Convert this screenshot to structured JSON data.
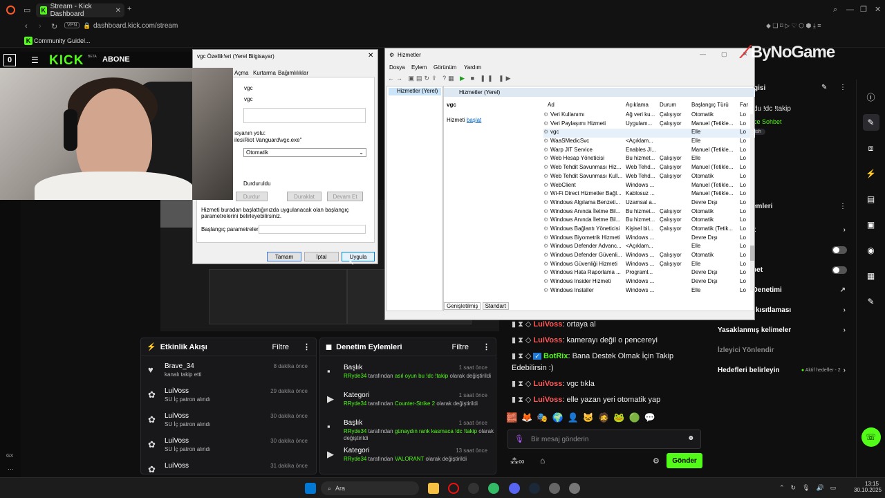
{
  "browser": {
    "tab_title": "Stream - Kick Dashboard",
    "vpn_label": "VPN",
    "url": "dashboard.kick.com/stream",
    "bookmark": "Community Guidel..."
  },
  "kick": {
    "logo": "KICK",
    "beta": "BETA",
    "abone": "ABONE",
    "watermark": "ByNoGame"
  },
  "activity": {
    "title": "Etkinlik Akışı",
    "filter": "Filtre",
    "items": [
      {
        "name": "Brave_34",
        "time": "8 dakika önce",
        "sub": "kanalı takip etti"
      },
      {
        "name": "LuiVoss",
        "time": "29 dakika önce",
        "sub": "SU İç patron alındı"
      },
      {
        "name": "LuiVoss",
        "time": "30 dakika önce",
        "sub": "SU İç patron alındı"
      },
      {
        "name": "LuiVoss",
        "time": "30 dakika önce",
        "sub": "SU İç patron alındı"
      },
      {
        "name": "LuiVoss",
        "time": "31 dakika önce",
        "sub": ""
      }
    ]
  },
  "moderation": {
    "title": "Denetim Eylemleri",
    "filter": "Filtre",
    "items": [
      {
        "type": "Başlık",
        "time": "1 saat önce",
        "user": "RRyde34",
        "pre": " tarafından ",
        "hl": "asıl oyun bu !dc !takip",
        "post": " olarak değiştirildi"
      },
      {
        "type": "Kategori",
        "time": "1 saat önce",
        "user": "RRyde34",
        "pre": " tarafından ",
        "hl": "Counter-Strike 2",
        "post": " olarak değiştirildi"
      },
      {
        "type": "Başlık",
        "time": "1 saat önce",
        "user": "RRyde34",
        "pre": " tarafından ",
        "hl": "günaydın rank kasmaca !dc !takip",
        "post": " olarak değiştirildi"
      },
      {
        "type": "Kategori",
        "time": "13 saat önce",
        "user": "RRyde34",
        "pre": " tarafından ",
        "hl": "VALORANT",
        "post": " olarak değiştirildi"
      }
    ]
  },
  "chat": {
    "lines": [
      {
        "user": "LuiVoss",
        "msg": ": ortaya al",
        "bot": false
      },
      {
        "user": "LuiVoss",
        "msg": ": kamerayı değil o pencereyi",
        "bot": false
      },
      {
        "user": "BotRix",
        "msg": ": Bana Destek Olmak İçin Takip Edebilirsin :)",
        "bot": true
      },
      {
        "user": "LuiVoss",
        "msg": ": vgc tıkla",
        "bot": false
      },
      {
        "user": "LuiVoss",
        "msg": ": elle yazan yeri otomatik yap",
        "bot": false
      }
    ],
    "placeholder": "Bir mesaj gönderin",
    "send": "Gönder"
  },
  "settings": {
    "top_title": "gisi",
    "stream_title": "du !dc !takip",
    "chat_label": "ce Sohbet",
    "tag": "ish",
    "section": "emleri",
    "items": [
      {
        "label": "özel sohbet",
        "kind": "chev"
      },
      {
        "label": "zel sohbet",
        "kind": "toggle"
      },
      {
        "label": "ederle sohbet",
        "kind": "toggle"
      },
      {
        "label": "ile Sohbet Denetimi",
        "kind": "ext"
      },
      {
        "label": "Hesap yaşı kısıtlaması",
        "kind": "chev"
      },
      {
        "label": "Yasaklanmış kelimeler",
        "kind": "chev"
      },
      {
        "label": "İzleyici Yönlendir",
        "kind": "none"
      },
      {
        "label": "Hedefleri belirleyin",
        "kind": "goals"
      }
    ],
    "goals_badge": "Aktif hedefler - 2"
  },
  "vgc_dialog": {
    "title": "vgc Özellikleri (Yerel Bilgisayar)",
    "tabs": [
      "Açma",
      "Kurtarma",
      "Bağımlılıklar"
    ],
    "service_name": "vgc",
    "display_name": "vgc",
    "path_label": "ısyanın yolu:",
    "path_value": "iles\\Riot Vanguard\\vgc.exe\"",
    "startup_type": "Otomatik",
    "status_value": "Durduruldu",
    "btn_stop": "Durdur",
    "btn_pause": "Duraklat",
    "btn_resume": "Devam Et",
    "info_text": "Hizmeti buradan başlattığınızda uygulanacak olan başlangıç parametrelerini belirleyebilirsiniz.",
    "params_label": "Başlangıç parametreleri:",
    "ok": "Tamam",
    "cancel": "İptal",
    "apply": "Uygula"
  },
  "services": {
    "title": "Hizmetler",
    "menu": [
      "Dosya",
      "Eylem",
      "Görünüm",
      "Yardım"
    ],
    "tree_item": "Hizmetler (Yerel)",
    "header": "Hizmetler (Yerel)",
    "selected": "vgc",
    "start_prefix": "Hizmeti ",
    "start_link": "başlat",
    "columns": [
      "Ad",
      "Açıklama",
      "Durum",
      "Başlangıç Türü",
      "Far"
    ],
    "rows": [
      [
        "Veri Kullanımı",
        "Ağ veri ku...",
        "Çalışıyor",
        "Otomatik",
        "Lo"
      ],
      [
        "Veri Paylaşımı Hizmeti",
        "Uygulam...",
        "Çalışıyor",
        "Manuel (Tetikle...",
        "Lo"
      ],
      [
        "vgc",
        "",
        "",
        "Elle",
        "Lo"
      ],
      [
        "WaaSMedicSvc",
        "<Açıklam...",
        "",
        "Elle",
        "Lo"
      ],
      [
        "Warp JIT Service",
        "Enables JI...",
        "",
        "Manuel (Tetikle...",
        "Lo"
      ],
      [
        "Web Hesap Yöneticisi",
        "Bu hizmet...",
        "Çalışıyor",
        "Elle",
        "Lo"
      ],
      [
        "Web Tehdit Savunması Hiz...",
        "Web Tehd...",
        "Çalışıyor",
        "Manuel (Tetikle...",
        "Lo"
      ],
      [
        "Web Tehdit Savunması Kull...",
        "Web Tehd...",
        "Çalışıyor",
        "Otomatik",
        "Lo"
      ],
      [
        "WebClient",
        "Windows ...",
        "",
        "Manuel (Tetikle...",
        "Lo"
      ],
      [
        "Wi-Fi Direct Hizmetler Bağl...",
        "Kablosuz ...",
        "",
        "Manuel (Tetikle...",
        "Lo"
      ],
      [
        "Windows Algılama Benzeti...",
        "Uzamsal a...",
        "",
        "Devre Dışı",
        "Lo"
      ],
      [
        "Windows Anında İletme Bil...",
        "Bu hizmet...",
        "Çalışıyor",
        "Otomatik",
        "Lo"
      ],
      [
        "Windows Anında İletme Bil...",
        "Bu hizmet...",
        "Çalışıyor",
        "Otomatik",
        "Lo"
      ],
      [
        "Windows Bağlantı Yöneticisi",
        "Kişisel bil...",
        "Çalışıyor",
        "Otomatik (Tetik...",
        "Lo"
      ],
      [
        "Windows Biyometrik Hizmeti",
        "Windows ...",
        "",
        "Devre Dışı",
        "Lo"
      ],
      [
        "Windows Defender Advanc...",
        "<Açıklam...",
        "",
        "Elle",
        "Lo"
      ],
      [
        "Windows Defender Güvenli...",
        "Windows ...",
        "Çalışıyor",
        "Otomatik",
        "Lo"
      ],
      [
        "Windows Güvenliği Hizmeti",
        "Windows ...",
        "Çalışıyor",
        "Elle",
        "Lo"
      ],
      [
        "Windows Hata Raporlama ...",
        "Programl...",
        "",
        "Devre Dışı",
        "Lo"
      ],
      [
        "Windows Insider Hizmeti",
        "Windows ...",
        "",
        "Devre Dışı",
        "Lo"
      ],
      [
        "Windows Installer",
        "Windows ...",
        "",
        "Elle",
        "Lo"
      ]
    ],
    "tabs": [
      "Genişletilmiş",
      "Standart"
    ]
  },
  "taskbar": {
    "search": "Ara",
    "time": "13:15",
    "date": "30.10.2025"
  },
  "colors": {
    "kick_green": "#53fc18",
    "chat_user": "#ff5a5a"
  }
}
